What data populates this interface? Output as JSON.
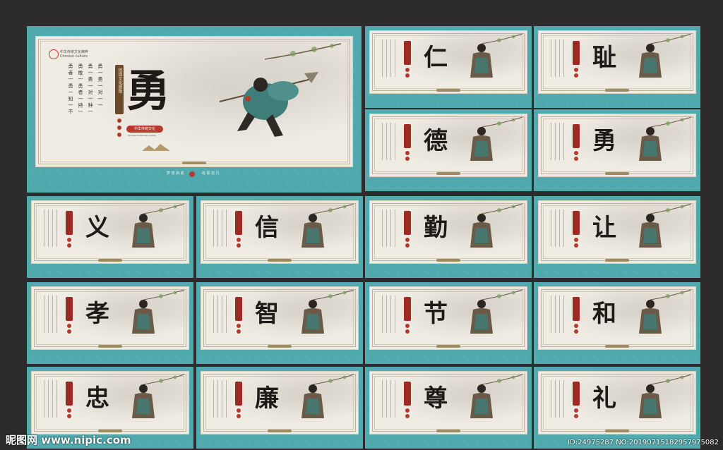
{
  "main_board": {
    "character": "勇",
    "logo_text_cn": "中华传统文化精粹",
    "logo_text_en": "Chinese culture",
    "banner_text": "校园文化展板",
    "badge_text": "中华传统文化",
    "badge_sub": "Chinese traditional culture",
    "column_text": [
      "勇 一 勇 一 对 一 一",
      "勇 一 勇 一 对 一 种 一",
      "勇 敢 一 勇 者 一 持 一",
      "勇 者 一 勇 一 知 一 不"
    ],
    "footer_left": "梦 想 启 航",
    "footer_right": "砥 砺 前 行"
  },
  "boards": [
    {
      "char": "仁"
    },
    {
      "char": "耻"
    },
    {
      "char": "德"
    },
    {
      "char": "勇"
    },
    {
      "char": "义"
    },
    {
      "char": "信"
    },
    {
      "char": "勤"
    },
    {
      "char": "让"
    },
    {
      "char": "孝"
    },
    {
      "char": "智"
    },
    {
      "char": "节"
    },
    {
      "char": "和"
    },
    {
      "char": "忠"
    },
    {
      "char": "廉"
    },
    {
      "char": "尊"
    },
    {
      "char": "礼"
    }
  ],
  "watermark": {
    "site": "昵图网 www.nipic.com",
    "id": "ID:24975287 NO:20190715182957975082"
  },
  "colors": {
    "board_teal": "#4fa9ad",
    "paper": "#efece4",
    "seal_red": "#b53a2e",
    "ink": "#1d1a17"
  }
}
